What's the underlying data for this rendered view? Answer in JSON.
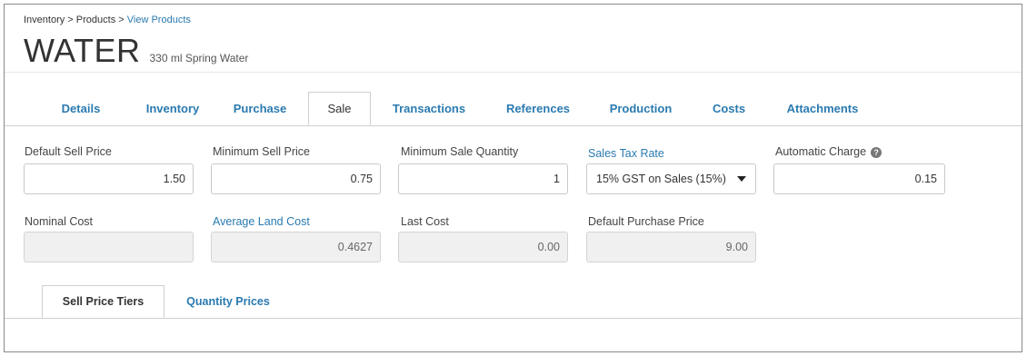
{
  "breadcrumb": {
    "part1": "Inventory",
    "sep1": " > ",
    "part2": "Products",
    "sep2": " > ",
    "current": "View Products"
  },
  "product": {
    "code": "WATER",
    "description": "330 ml Spring Water"
  },
  "tabs": [
    {
      "label": "Details"
    },
    {
      "label": "Inventory"
    },
    {
      "label": "Purchase"
    },
    {
      "label": "Sale"
    },
    {
      "label": "Transactions"
    },
    {
      "label": "References"
    },
    {
      "label": "Production"
    },
    {
      "label": "Costs"
    },
    {
      "label": "Attachments"
    }
  ],
  "sale": {
    "default_sell_price": {
      "label": "Default Sell Price",
      "value": "1.50"
    },
    "minimum_sell_price": {
      "label": "Minimum Sell Price",
      "value": "0.75"
    },
    "minimum_sale_quantity": {
      "label": "Minimum Sale Quantity",
      "value": "1"
    },
    "sales_tax_rate": {
      "label": "Sales Tax Rate",
      "value": "15% GST on Sales (15%)"
    },
    "automatic_charge": {
      "label": "Automatic Charge",
      "value": "0.15",
      "help_icon": "question-circle-icon"
    },
    "nominal_cost": {
      "label": "Nominal Cost",
      "value": ""
    },
    "average_land_cost": {
      "label": "Average Land Cost",
      "value": "0.4627"
    },
    "last_cost": {
      "label": "Last Cost",
      "value": "0.00"
    },
    "default_purchase_price": {
      "label": "Default Purchase Price",
      "value": "9.00"
    }
  },
  "subtabs": [
    {
      "label": "Sell Price Tiers"
    },
    {
      "label": "Quantity Prices"
    }
  ],
  "colors": {
    "link": "#2a7ab0",
    "border": "#cfcfcf",
    "readonly_bg": "#f0f0f0"
  }
}
